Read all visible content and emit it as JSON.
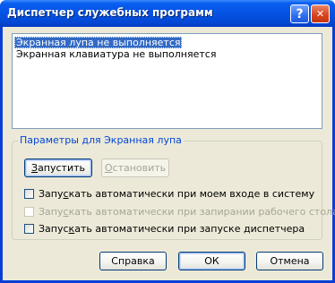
{
  "window": {
    "title": "Диспетчер служебных программ",
    "help_glyph": "?",
    "close_glyph": "✕"
  },
  "programs": [
    {
      "text": "Экранная лупа не выполняется",
      "selected": true
    },
    {
      "text": "Экранная клавиатура не выполняется",
      "selected": false
    }
  ],
  "options": {
    "caption": "Параметры для Экранная лупа",
    "start_button": {
      "label_prefix": "",
      "accel": "З",
      "label_rest": "апустить",
      "enabled": true
    },
    "stop_button": {
      "label_prefix": "",
      "accel": "О",
      "label_rest": "становить",
      "enabled": false
    },
    "checkboxes": [
      {
        "prefix": "Запу",
        "accel": "с",
        "rest": "кать автоматически при моем входе в систему",
        "checked": false,
        "enabled": true
      },
      {
        "prefix": "Запу",
        "accel": "с",
        "rest": "кать автоматически при запирании рабочего стола",
        "checked": false,
        "enabled": false
      },
      {
        "prefix": "Запус",
        "accel": "к",
        "rest": "ать автоматически при запуске диспетчера",
        "checked": false,
        "enabled": true
      }
    ]
  },
  "footer": {
    "help_label": "Справка",
    "ok_label": "ОК",
    "cancel_label": "Отмена"
  }
}
